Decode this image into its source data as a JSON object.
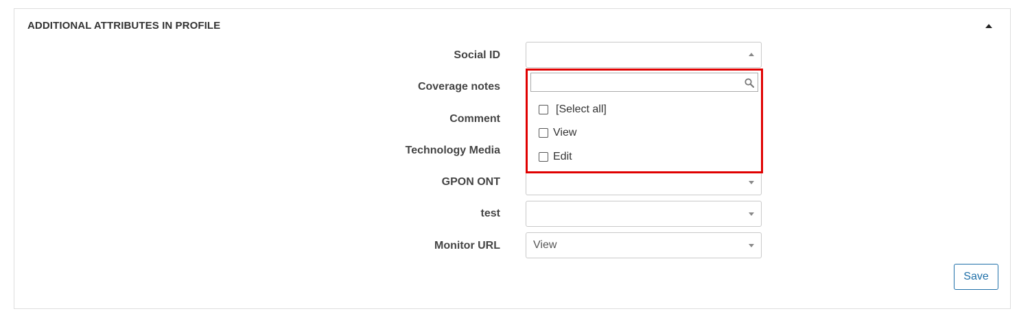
{
  "panel": {
    "title": "ADDITIONAL ATTRIBUTES IN PROFILE"
  },
  "fields": [
    {
      "label": "Social ID",
      "value": ""
    },
    {
      "label": "Coverage notes",
      "value": ""
    },
    {
      "label": "Comment",
      "value": ""
    },
    {
      "label": "Technology Media",
      "value": ""
    },
    {
      "label": "GPON ONT",
      "value": ""
    },
    {
      "label": "test",
      "value": ""
    },
    {
      "label": "Monitor URL",
      "value": "View"
    }
  ],
  "dropdown": {
    "search_value": "",
    "options": [
      {
        "label": "[Select all]",
        "checked": false
      },
      {
        "label": "View",
        "checked": false
      },
      {
        "label": "Edit",
        "checked": false
      }
    ],
    "highlight_color": "#e00000"
  },
  "actions": {
    "save_label": "Save"
  }
}
